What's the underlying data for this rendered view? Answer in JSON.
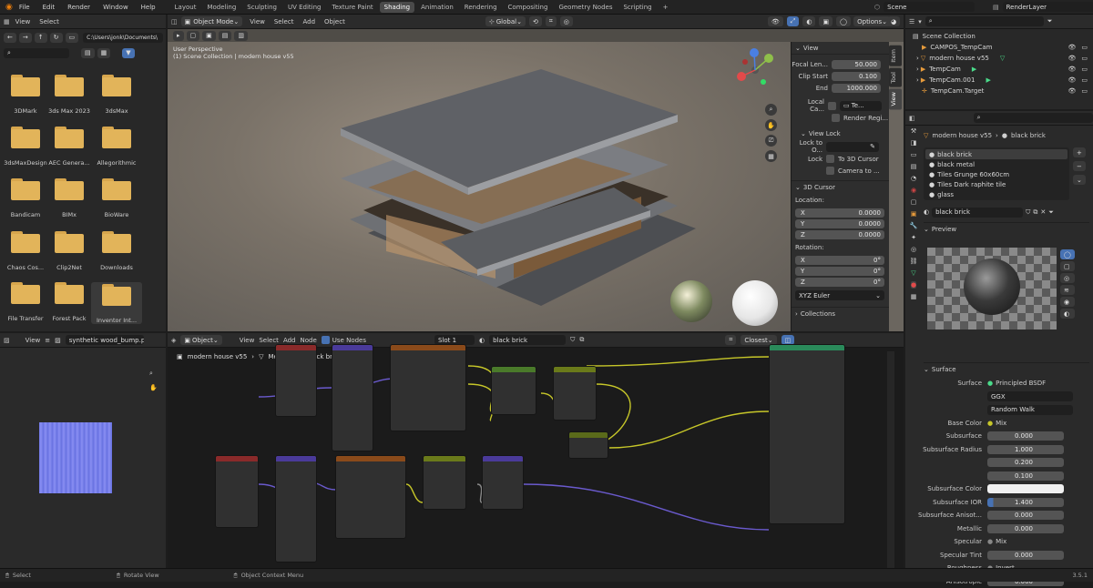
{
  "topbar": {
    "menus": [
      "File",
      "Edit",
      "Render",
      "Window",
      "Help"
    ],
    "workspaces": [
      "Layout",
      "Modeling",
      "Sculpting",
      "UV Editing",
      "Texture Paint",
      "Shading",
      "Animation",
      "Rendering",
      "Compositing",
      "Geometry Nodes",
      "Scripting"
    ],
    "active_workspace": "Shading",
    "add_tab": "+",
    "scene": "Scene",
    "view_layer": "RenderLayer"
  },
  "filebrowser": {
    "menu": [
      "View",
      "Select"
    ],
    "path": "C:\\Users\\jonk\\Documents\\",
    "items": [
      "3DMark",
      "3ds Max 2023",
      "3dsMax",
      "3dsMaxDesign",
      "AEC Genera...",
      "Allegorithmic",
      "Bandicam",
      "BIMx",
      "BioWare",
      "Chaos Cos...",
      "Clip2Net",
      "Downloads",
      "File Transfer",
      "Forest Pack",
      "Inventor Int..."
    ]
  },
  "viewport": {
    "mode": "Object Mode",
    "menu": [
      "View",
      "Select",
      "Add",
      "Object"
    ],
    "orientation": "Global",
    "options": "Options",
    "overlay_line1": "User Perspective",
    "overlay_line2": "(1) Scene Collection | modern house v55",
    "npanel": {
      "view_title": "View",
      "focal_label": "Focal Len...",
      "focal_value": "50.000",
      "clip_start_label": "Clip Start",
      "clip_start_value": "0.100",
      "end_label": "End",
      "end_value": "1000.000",
      "local_cam_label": "Local Ca...",
      "local_cam_value": "Te...",
      "render_region": "Render Regi...",
      "view_lock_title": "View Lock",
      "lock_to_label": "Lock to O...",
      "lock_label": "Lock",
      "to_3d_cursor": "To 3D Cursor",
      "camera_to": "Camera to ...",
      "cursor_title": "3D Cursor",
      "location_label": "Location:",
      "x_label": "X",
      "y_label": "Y",
      "z_label": "Z",
      "loc_x": "0.0000",
      "loc_y": "0.0000",
      "loc_z": "0.0000",
      "rotation_label": "Rotation:",
      "rot_x": "0°",
      "rot_y": "0°",
      "rot_z": "0°",
      "rot_mode": "XYZ Euler",
      "collections": "Collections"
    },
    "side_tabs": [
      "Item",
      "Tool",
      "View"
    ]
  },
  "imageeditor": {
    "menu": [
      "View"
    ],
    "image_name": "synthetic wood_bump.p"
  },
  "nodeeditor": {
    "object": "Object",
    "menu": [
      "View",
      "Select",
      "Add",
      "Node"
    ],
    "use_nodes": "Use Nodes",
    "slot": "Slot 1",
    "material": "black brick",
    "interp": "Closest",
    "breadcrumb": [
      "modern house v55",
      "Mesh",
      "black brick"
    ]
  },
  "outliner": {
    "title": "Scene Collection",
    "items": [
      "CAMPOS_TempCam",
      "modern house v55",
      "TempCam",
      "TempCam.001",
      "TempCam.Target"
    ]
  },
  "properties": {
    "breadcrumb_obj": "modern house v55",
    "breadcrumb_mat": "black brick",
    "materials": [
      "black brick",
      "black metal",
      "Tiles Grunge 60x60cm",
      "Tiles Dark raphite tile",
      "glass"
    ],
    "material_name": "black brick",
    "preview_title": "Preview",
    "surface_title": "Surface",
    "rows": [
      {
        "label": "Surface",
        "value": "Principled BSDF"
      },
      {
        "label": "",
        "value": "GGX"
      },
      {
        "label": "",
        "value": "Random Walk"
      },
      {
        "label": "Base Color",
        "value": "Mix"
      },
      {
        "label": "Subsurface",
        "value": "0.000"
      },
      {
        "label": "Subsurface Radius",
        "value": "1.000"
      },
      {
        "label": "",
        "value": "0.200"
      },
      {
        "label": "",
        "value": "0.100"
      },
      {
        "label": "Subsurface Color",
        "value": ""
      },
      {
        "label": "Subsurface IOR",
        "value": "1.400"
      },
      {
        "label": "Subsurface Anisot...",
        "value": "0.000"
      },
      {
        "label": "Metallic",
        "value": "0.000"
      },
      {
        "label": "Specular",
        "value": "Mix"
      },
      {
        "label": "Specular Tint",
        "value": "0.000"
      },
      {
        "label": "Roughness",
        "value": "Invert"
      },
      {
        "label": "Anisotropic",
        "value": "0.000"
      }
    ]
  },
  "statusbar": {
    "select": "Select",
    "rotate": "Rotate View",
    "context": "Object Context Menu",
    "version": "3.5.1"
  },
  "colors": {
    "accent": "#4772b3",
    "active_tab": "#4a4a4a",
    "folder": "#e2b45a"
  }
}
